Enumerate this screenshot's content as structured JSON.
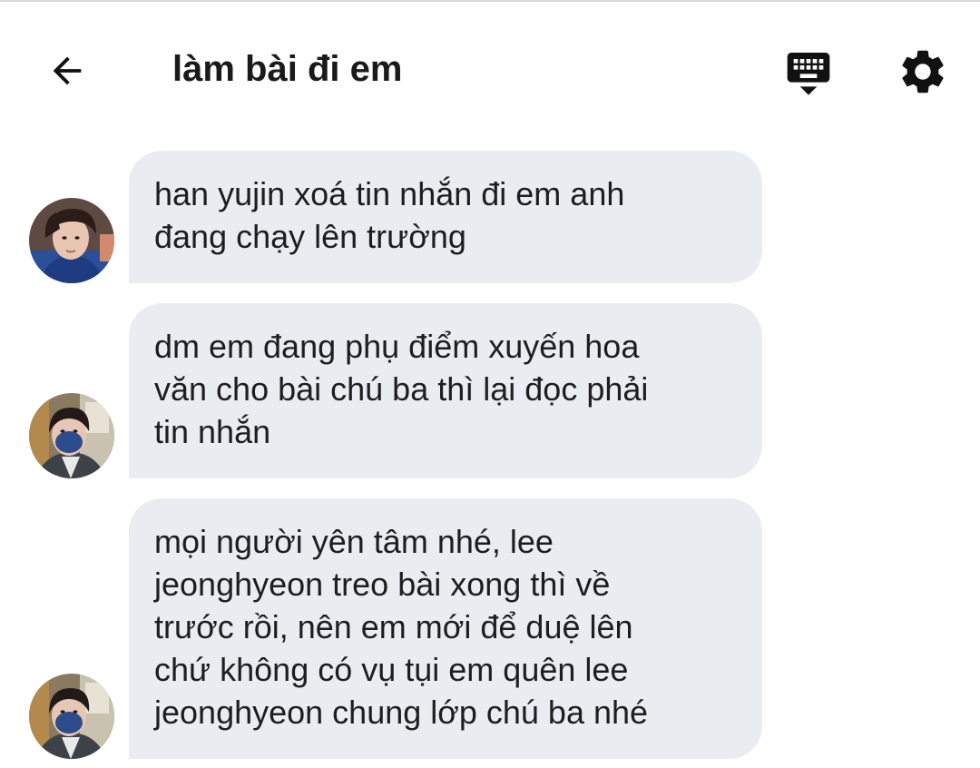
{
  "header": {
    "title": "làm bài đi em",
    "back_icon": "arrow-left-icon",
    "keyboard_icon": "keyboard-hide-icon",
    "settings_icon": "gear-icon"
  },
  "colors": {
    "bubble": "#e9edf2",
    "text": "#1e1e1e",
    "icon": "#111111"
  },
  "messages": [
    {
      "avatar_icon": "user-avatar-photo",
      "text": "han yujin xoá tin nhắn đi em anh\nđang chạy lên trường"
    },
    {
      "avatar_icon": "user-avatar-photo",
      "text": "dm em đang phụ điểm xuyến hoa\nvăn cho bài chú ba thì lại đọc phải\ntin nhắn"
    },
    {
      "avatar_icon": "user-avatar-photo",
      "text": "mọi người yên tâm nhé, lee\njeonghyeon treo bài xong thì về\ntrước rồi, nên em mới để duệ lên\nchứ không có vụ tụi em quên lee\njeonghyeon chung lớp chú ba nhé"
    }
  ]
}
